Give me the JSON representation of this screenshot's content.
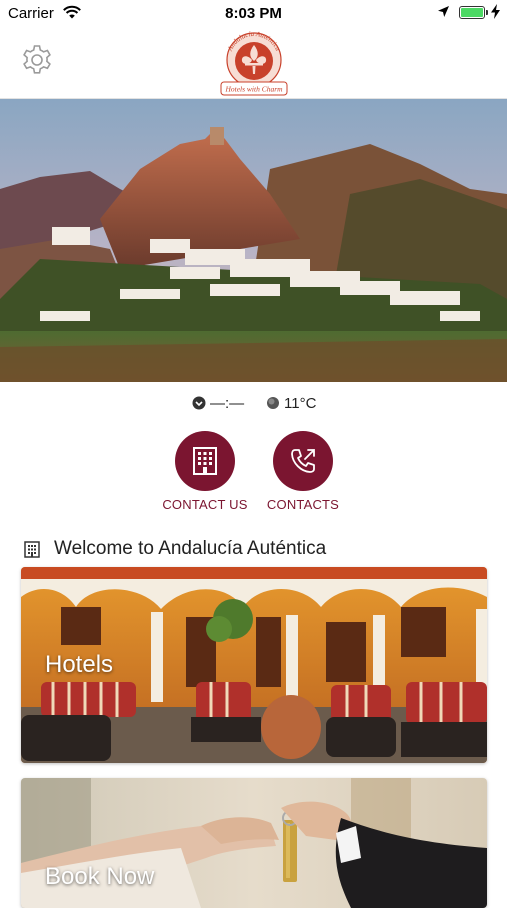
{
  "status_bar": {
    "carrier": "Carrier",
    "time": "8:03 PM",
    "battery_color": "#4cd964"
  },
  "header": {
    "logo_text_top": "Andalucía Auténtica",
    "logo_text_bottom": "Hotels with Charm",
    "settings_icon": "gear-icon"
  },
  "info": {
    "time_value": "—:—",
    "temperature": "11°C"
  },
  "actions": [
    {
      "label": "CONTACT US",
      "icon": "building-icon"
    },
    {
      "label": "CONTACTS",
      "icon": "phone-outgoing-icon"
    }
  ],
  "section": {
    "title": "Welcome to Andalucía Auténtica",
    "icon": "building-icon"
  },
  "cards": [
    {
      "label": "Hotels"
    },
    {
      "label": "Book Now"
    }
  ],
  "colors": {
    "accent": "#7b1530",
    "logo_red": "#c8412b"
  }
}
